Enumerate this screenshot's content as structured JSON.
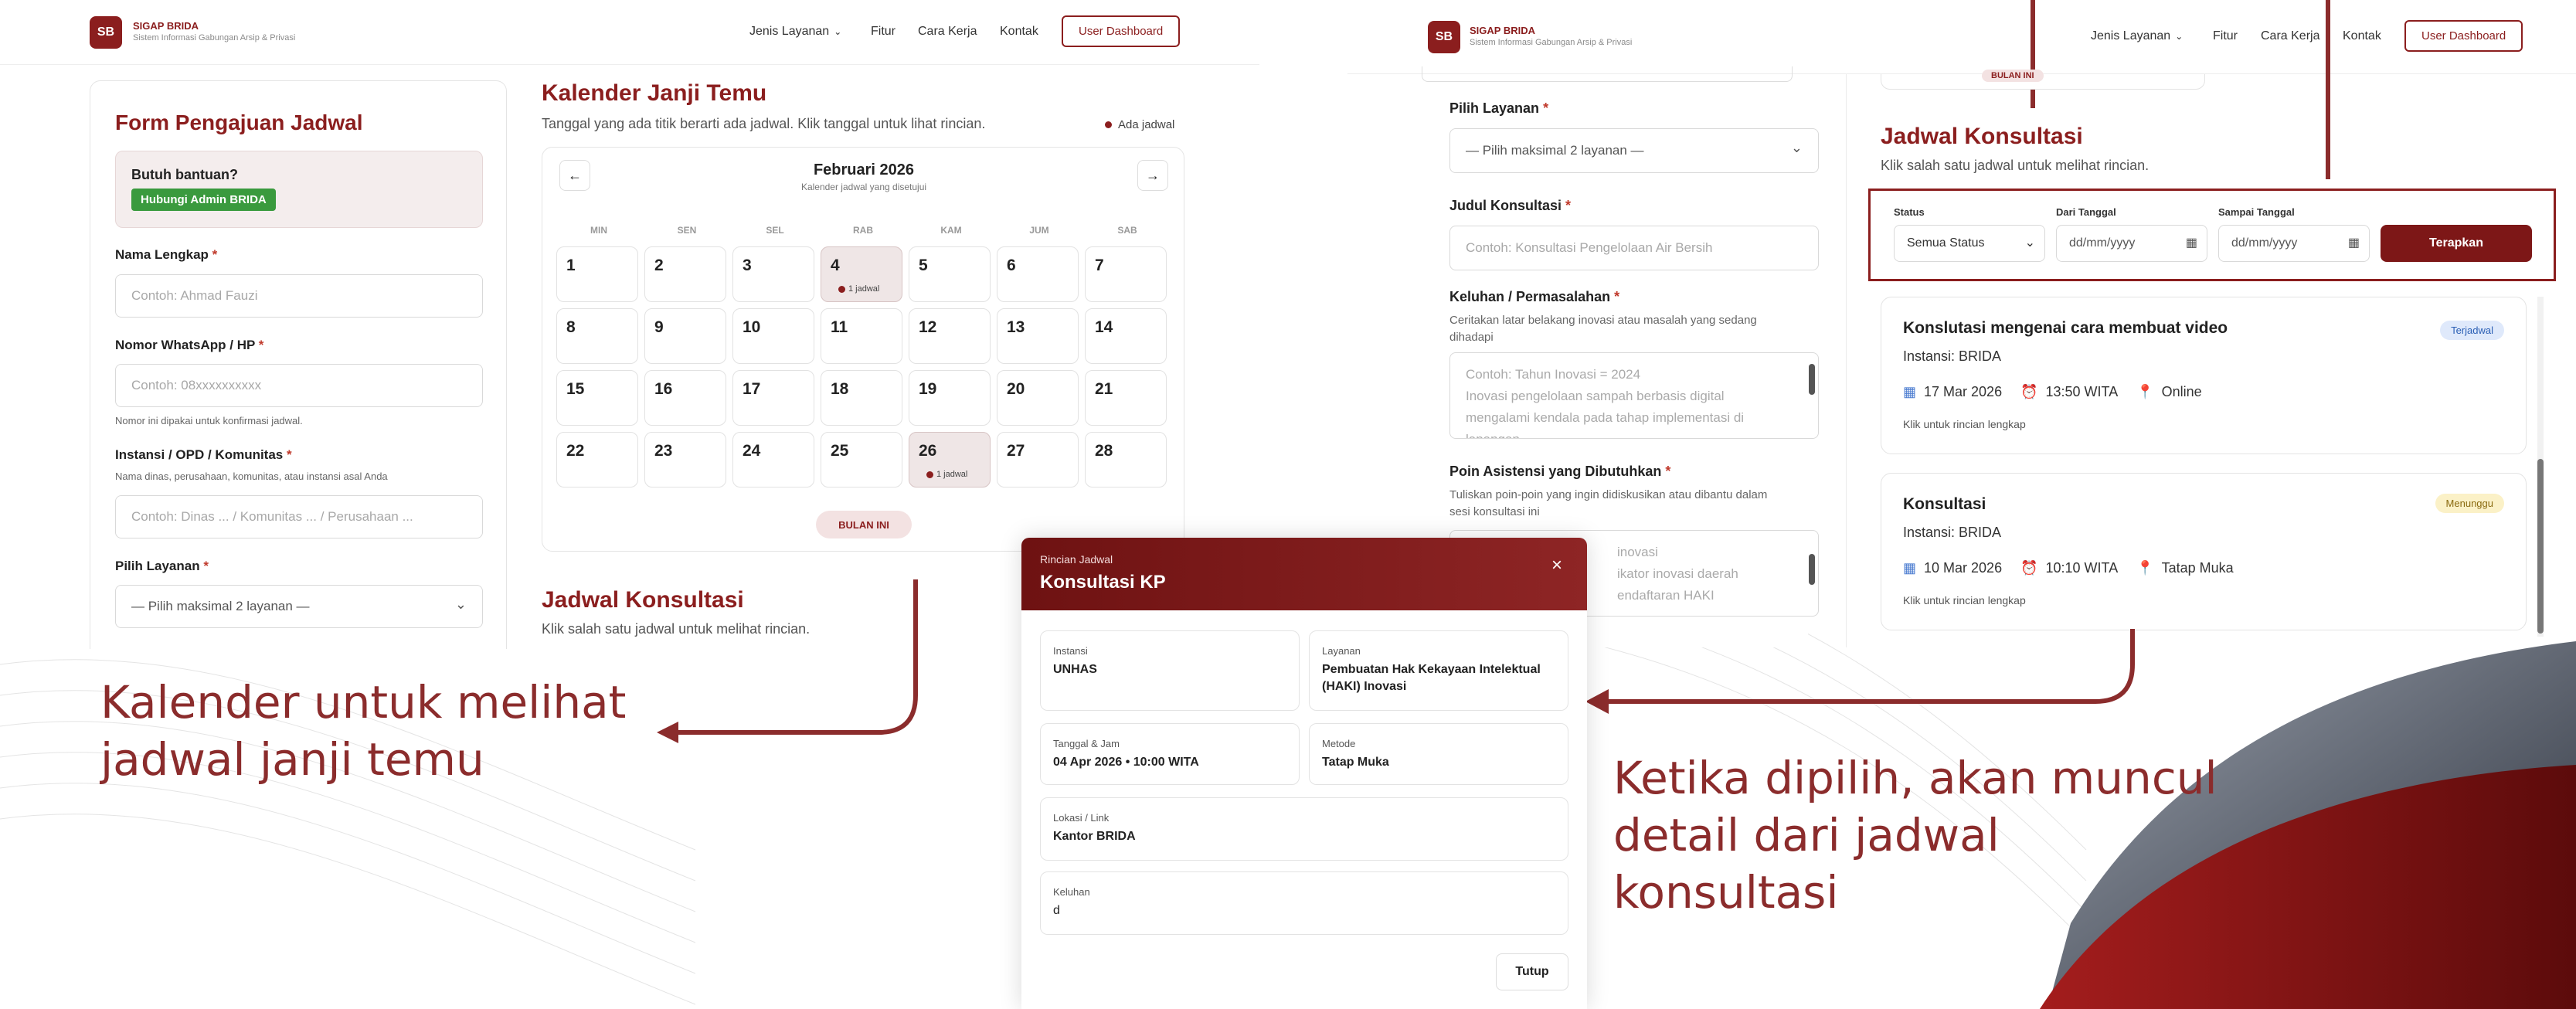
{
  "app": {
    "logo_initials": "SB",
    "brand_title": "SIGAP BRIDA",
    "brand_subtitle": "Sistem Informasi Gabungan Arsip & Privasi",
    "nav_jenis": "Jenis Layanan",
    "nav_fitur": "Fitur",
    "nav_cara": "Cara Kerja",
    "nav_kontak": "Kontak",
    "nav_dashboard": "User Dashboard"
  },
  "form": {
    "title": "Form Pengajuan Jadwal",
    "help_title": "Butuh bantuan?",
    "help_button": "Hubungi Admin BRIDA",
    "nama_label": "Nama Lengkap",
    "nama_placeholder": "Contoh: Ahmad Fauzi",
    "wa_label": "Nomor WhatsApp / HP",
    "wa_placeholder": "Contoh: 08xxxxxxxxxx",
    "wa_hint": "Nomor ini dipakai untuk konfirmasi jadwal.",
    "instansi_label": "Instansi / OPD / Komunitas",
    "instansi_hint": "Nama dinas, perusahaan, komunitas, atau instansi asal Anda",
    "instansi_placeholder": "Contoh: Dinas ... / Komunitas ... / Perusahaan ...",
    "layanan_label": "Pilih Layanan",
    "layanan_placeholder": "— Pilih maksimal 2 layanan —",
    "required_mark": "*"
  },
  "calendar": {
    "title": "Kalender Janji Temu",
    "subtitle": "Tanggal yang ada titik berarti ada jadwal. Klik tanggal untuk lihat rincian.",
    "legend": "Ada jadwal",
    "month": "Februari 2026",
    "month_sub": "Kalender jadwal yang disetujui",
    "prev": "←",
    "next": "→",
    "weekdays": [
      "MIN",
      "SEN",
      "SEL",
      "RAB",
      "KAM",
      "JUM",
      "SAB"
    ],
    "days": [
      "1",
      "2",
      "3",
      "4",
      "5",
      "6",
      "7",
      "8",
      "9",
      "10",
      "11",
      "12",
      "13",
      "14",
      "15",
      "16",
      "17",
      "18",
      "19",
      "20",
      "21",
      "22",
      "23",
      "24",
      "25",
      "26",
      "27",
      "28"
    ],
    "event_label": "1 jadwal",
    "today_button": "BULAN INI",
    "jadwal_title": "Jadwal Konsultasi",
    "jadwal_sub": "Klik salah satu jadwal untuk melihat rincian."
  },
  "captions": {
    "left_line1": "Kalender untuk melihat",
    "left_line2": "jadwal janji temu",
    "right_line1": "Ketika dipilih, akan muncul",
    "right_line2": "detail dari jadwal",
    "right_line3": "konsultasi"
  },
  "modal": {
    "eyebrow": "Rincian Jadwal",
    "title": "Konsultasi KP",
    "close": "×",
    "instansi_k": "Instansi",
    "instansi_v": "UNHAS",
    "layanan_k": "Layanan",
    "layanan_v1": "Pembuatan Hak Kekayaan Intelektual",
    "layanan_v2": "(HAKI) Inovasi",
    "tanggal_k": "Tanggal & Jam",
    "tanggal_v": "04 Apr 2026 • 10:00 WITA",
    "metode_k": "Metode",
    "metode_v": "Tatap Muka",
    "lokasi_k": "Lokasi / Link",
    "lokasi_v": "Kantor BRIDA",
    "keluhan_k": "Keluhan",
    "keluhan_v": "d",
    "tutup": "Tutup"
  },
  "right_form": {
    "layanan_label": "Pilih Layanan",
    "layanan_placeholder": "— Pilih maksimal 2 layanan —",
    "judul_label": "Judul Konsultasi",
    "judul_placeholder": "Contoh: Konsultasi Pengelolaan Air Bersih",
    "keluhan_label": "Keluhan / Permasalahan",
    "keluhan_hint1": "Ceritakan latar belakang inovasi atau masalah yang sedang",
    "keluhan_hint2": "dihadapi",
    "keluhan_ph1": "Contoh: Tahun Inovasi = 2024",
    "keluhan_ph2": "Inovasi pengelolaan sampah berbasis digital",
    "keluhan_ph3": "mengalami kendala pada tahap implementasi di",
    "keluhan_ph4": "lapangan",
    "poin_label": "Poin Asistensi yang Dibutuhkan",
    "poin_hint1": "Tuliskan poin-poin yang ingin didiskusikan atau dibantu dalam",
    "poin_hint2": "sesi konsultasi ini",
    "poin_ph1": "inovasi",
    "poin_ph2": "ikator inovasi daerah",
    "poin_ph3": "endaftaran HAKI",
    "top_button": "BULAN INI"
  },
  "jadwal_panel": {
    "title": "Jadwal Konsultasi",
    "subtitle": "Klik salah satu jadwal untuk melihat rincian.",
    "status_label": "Status",
    "status_value": "Semua Status",
    "dari_label": "Dari Tanggal",
    "dari_placeholder": "dd/mm/yyyy",
    "sampai_label": "Sampai Tanggal",
    "sampai_placeholder": "dd/mm/yyyy",
    "apply": "Terapkan",
    "items": [
      {
        "title": "Konslutasi mengenai cara membuat video",
        "instansi": "Instansi: BRIDA",
        "date": "17 Mar 2026",
        "time": "13:50 WITA",
        "place": "Online",
        "hint": "Klik untuk rincian lengkap",
        "badge": "Terjadwal"
      },
      {
        "title": "Konsultasi",
        "instansi": "Instansi: BRIDA",
        "date": "10 Mar 2026",
        "time": "10:10 WITA",
        "place": "Tatap Muka",
        "hint": "Klik untuk rincian lengkap",
        "badge": "Menunggu"
      }
    ]
  },
  "colors": {
    "brand": "#8b1e1e",
    "accent_green": "#3a9a3e",
    "badge_blue_bg": "#dfe9fb",
    "badge_yellow_bg": "#fbf1c7"
  }
}
